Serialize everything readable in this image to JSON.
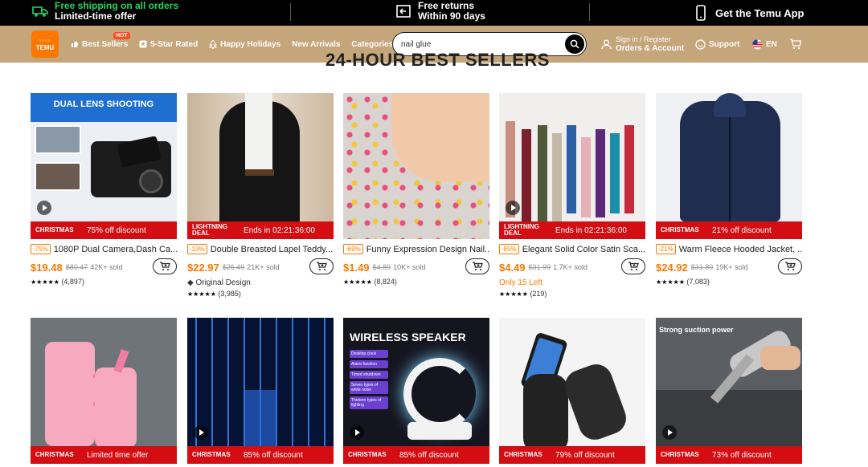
{
  "promo": {
    "shipping_l1": "Free shipping on all orders",
    "shipping_l2": "Limited-time offer",
    "returns_l1": "Free returns",
    "returns_l2": "Within 90 days",
    "app": "Get the Temu App"
  },
  "header": {
    "logo_l1": "TEMU",
    "nav": [
      "Best Sellers",
      "5-Star Rated",
      "Happy Holidays",
      "New Arrivals",
      "Categories"
    ],
    "hot_badge": "HOT",
    "search_value": "nail glue",
    "signin_l1": "Sign in / Register",
    "signin_l2": "Orders & Account",
    "support": "Support",
    "lang": "EN"
  },
  "section_title": "24-HOUR BEST SELLERS",
  "colors": {
    "accent": "#fb7701",
    "banner": "#d40d12",
    "header": "#c5a57a",
    "promo_green": "#1ed760"
  },
  "products_row1": [
    {
      "tag": "CHRISTMAS",
      "banner": "75% off discount",
      "pct": "-75%",
      "title": "1080P Dual Camera,Dash Ca...",
      "price": "$19.48",
      "old": "$80.47",
      "sold": "42K+ sold",
      "extra": "",
      "rating": "(4,897)"
    },
    {
      "tag": "LIGHTNING DEAL",
      "banner": "Ends in 02:21:36:00",
      "pct": "-13%",
      "title": "Double Breasted Lapel Teddy...",
      "price": "$22.97",
      "old": "$26.49",
      "sold": "21K+ sold",
      "extra": "Original Design",
      "rating": "(3,985)"
    },
    {
      "tag": "",
      "banner": "",
      "pct": "-69%",
      "title": "Funny Expression Design Nail...",
      "price": "$1.49",
      "old": "$4.89",
      "sold": "10K+ sold",
      "extra": "",
      "rating": "(8,824)"
    },
    {
      "tag": "LIGHTNING DEAL",
      "banner": "Ends in 02:21:36:00",
      "pct": "-85%",
      "title": "Elegant Solid Color Satin Sca...",
      "price": "$4.49",
      "old": "$31.99",
      "sold": "1.7K+ sold",
      "extra": "Only 15 Left",
      "rating": "(219)"
    },
    {
      "tag": "CHRISTMAS",
      "banner": "21% off discount",
      "pct": "-21%",
      "title": "Warm Fleece Hooded Jacket, ...",
      "price": "$24.92",
      "old": "$31.89",
      "sold": "19K+ sold",
      "extra": "",
      "rating": "(7,083)"
    }
  ],
  "products_row2": [
    {
      "tag": "CHRISTMAS",
      "banner": "Limited time offer",
      "img_text": ""
    },
    {
      "tag": "CHRISTMAS",
      "banner": "85% off discount",
      "img_text": ""
    },
    {
      "tag": "CHRISTMAS",
      "banner": "85% off discount",
      "img_text": "WIRELESS SPEAKER"
    },
    {
      "tag": "CHRISTMAS",
      "banner": "79% off discount",
      "img_text": ""
    },
    {
      "tag": "CHRISTMAS",
      "banner": "73% off discount",
      "img_text": "Strong suction power"
    }
  ],
  "img_text": {
    "dashcam": "DUAL LENS SHOOTING",
    "speaker_features": [
      "Desktop clock",
      "Alarm function",
      "Timed shutdown",
      "Seven types of white noise",
      "Thirteen types of lighting"
    ]
  }
}
